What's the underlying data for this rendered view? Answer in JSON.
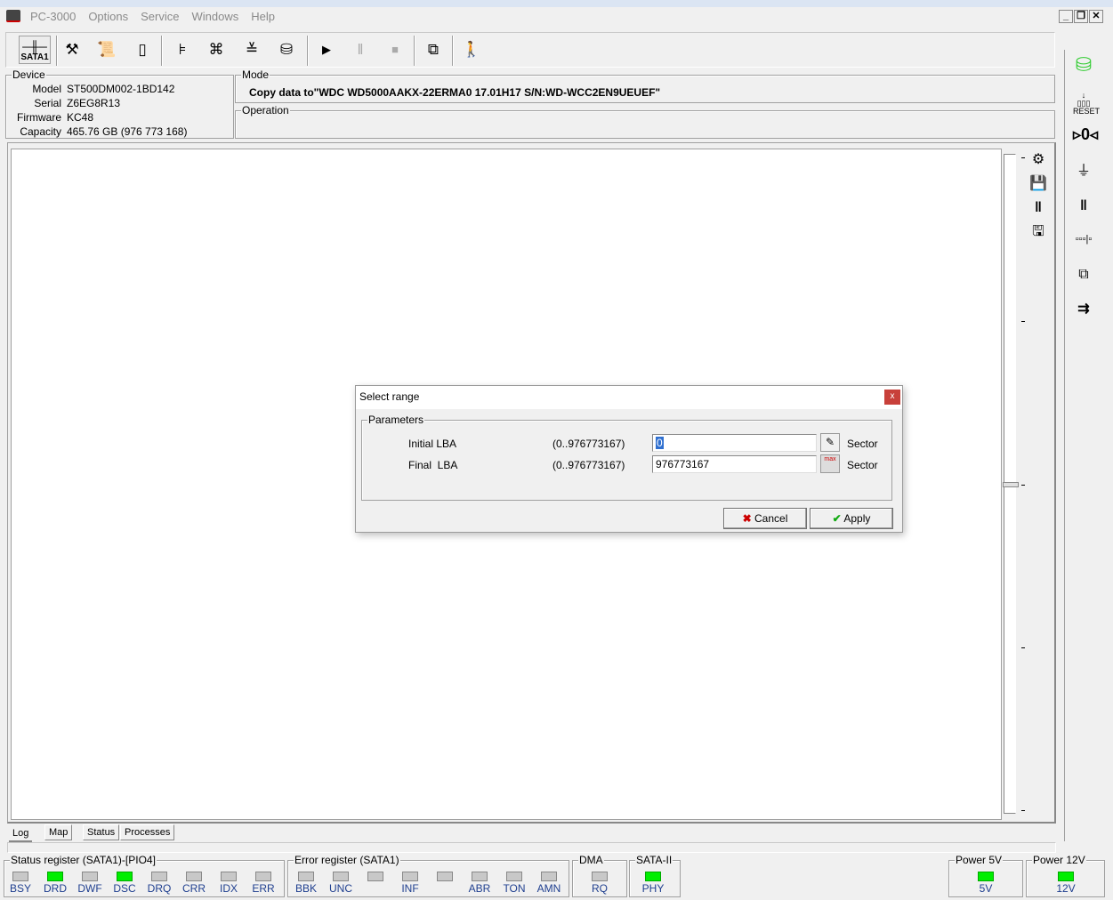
{
  "menu": {
    "items": [
      "PC-3000",
      "Options",
      "Service",
      "Windows",
      "Help"
    ]
  },
  "toolbar": {
    "sata_label": "SATA1"
  },
  "device": {
    "title": "Device",
    "model_label": "Model",
    "model": "ST500DM002-1BD142",
    "serial_label": "Serial",
    "serial": "Z6EG8R13",
    "firmware_label": "Firmware",
    "firmware": "KC48",
    "capacity_label": "Capacity",
    "capacity": "465.76 GB (976 773 168)"
  },
  "mode": {
    "title": "Mode",
    "text": "Copy data to\"WDC WD5000AAKX-22ERMA0 17.01H17 S/N:WD-WCC2EN9UEUEF\""
  },
  "operation": {
    "title": "Operation"
  },
  "tabs": [
    "Log",
    "Map",
    "Status",
    "Processes"
  ],
  "status_register": {
    "title": "Status register (SATA1)-[PIO4]",
    "leds": [
      {
        "label": "BSY",
        "on": false
      },
      {
        "label": "DRD",
        "on": true
      },
      {
        "label": "DWF",
        "on": false
      },
      {
        "label": "DSC",
        "on": true
      },
      {
        "label": "DRQ",
        "on": false
      },
      {
        "label": "CRR",
        "on": false
      },
      {
        "label": "IDX",
        "on": false
      },
      {
        "label": "ERR",
        "on": false
      }
    ]
  },
  "error_register": {
    "title": "Error register (SATA1)",
    "leds": [
      {
        "label": "BBK",
        "on": false
      },
      {
        "label": "UNC",
        "on": false
      },
      {
        "label": "",
        "on": false
      },
      {
        "label": "INF",
        "on": false
      },
      {
        "label": "",
        "on": false
      },
      {
        "label": "ABR",
        "on": false
      },
      {
        "label": "TON",
        "on": false
      },
      {
        "label": "AMN",
        "on": false
      }
    ]
  },
  "dma": {
    "title": "DMA",
    "leds": [
      {
        "label": "RQ",
        "on": false
      }
    ]
  },
  "sata2": {
    "title": "SATA-II",
    "leds": [
      {
        "label": "PHY",
        "on": true
      }
    ]
  },
  "power5": {
    "title": "Power 5V",
    "leds": [
      {
        "label": "5V",
        "on": true
      }
    ]
  },
  "power12": {
    "title": "Power 12V",
    "leds": [
      {
        "label": "12V",
        "on": true
      }
    ]
  },
  "dialog": {
    "title": "Select range",
    "close": "x",
    "group": "Parameters",
    "initial_label": "Initial LBA",
    "initial_range": "(0..976773167)",
    "initial_value": "0",
    "initial_unit": "Sector",
    "final_label": "Final  LBA",
    "final_range": "(0..976773167)",
    "final_value": "976773167",
    "final_unit": "Sector",
    "max_icon_text": "max",
    "cancel": "Cancel",
    "apply": "Apply"
  },
  "colors": {
    "led_on": "#00ee00",
    "led_off": "#c8c8c8",
    "led_label": "#1f3f8f",
    "close": "#c8403a"
  }
}
